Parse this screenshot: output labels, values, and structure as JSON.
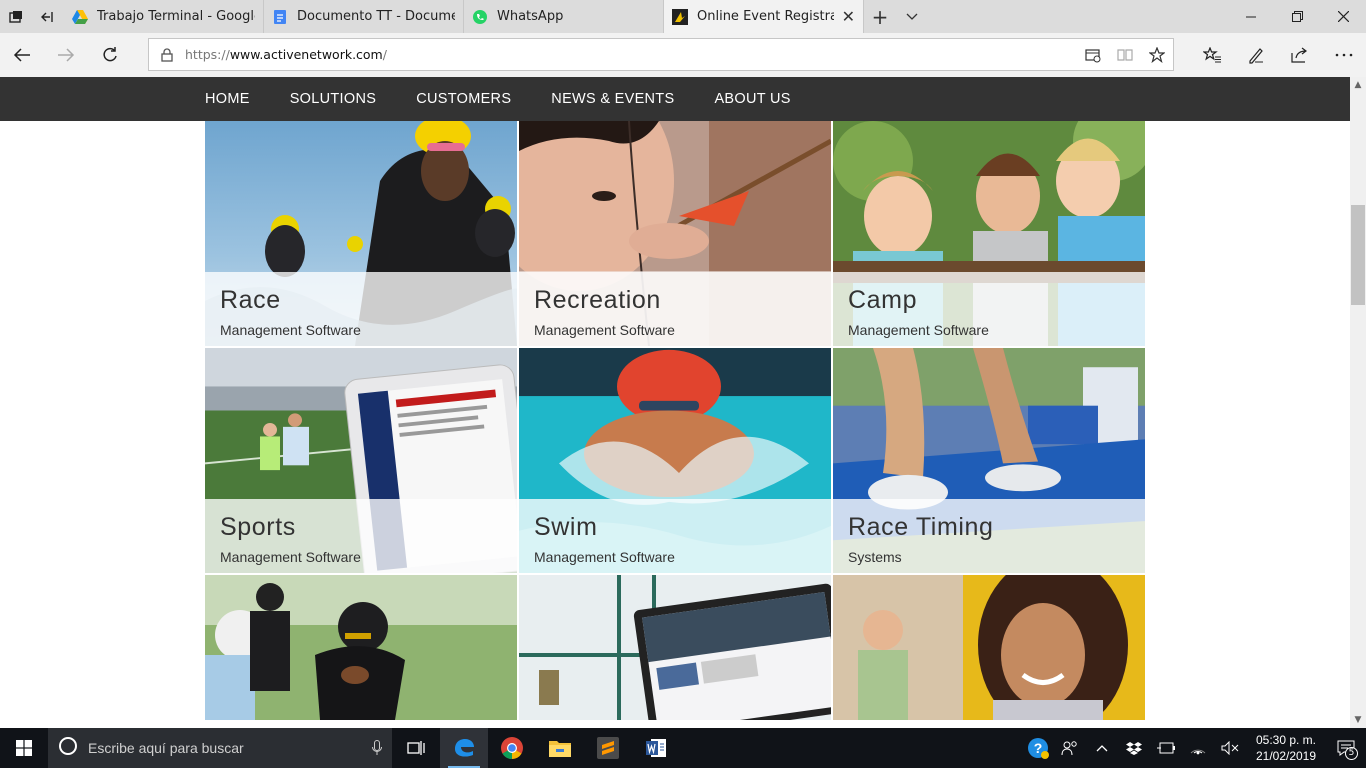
{
  "browser": {
    "tabs": [
      {
        "title": "Trabajo Terminal - Google D",
        "favicon": "google-drive-icon",
        "active": false
      },
      {
        "title": "Documento TT - Document",
        "favicon": "google-docs-icon",
        "active": false
      },
      {
        "title": "WhatsApp",
        "favicon": "whatsapp-icon",
        "active": false
      },
      {
        "title": "Online Event Registratic",
        "favicon": "active-network-icon",
        "active": true
      }
    ],
    "url_prefix": "https://",
    "url_host": "www.activenetwork.com",
    "url_path": "/"
  },
  "site": {
    "nav": [
      "HOME",
      "SOLUTIONS",
      "CUSTOMERS",
      "NEWS & EVENTS",
      "ABOUT US"
    ],
    "tiles": [
      {
        "name": "Race",
        "sub": "Management Software",
        "scene": "triathlon-swimmers"
      },
      {
        "name": "Recreation",
        "sub": "Management Software",
        "scene": "archery-girl"
      },
      {
        "name": "Camp",
        "sub": "Management Software",
        "scene": "camp-kids"
      },
      {
        "name": "Sports",
        "sub": "Management Software",
        "scene": "soccer-tablet"
      },
      {
        "name": "Swim",
        "sub": "Management Software",
        "scene": "swimmer"
      },
      {
        "name": "Race Timing",
        "sub": "Systems",
        "scene": "runners-feet"
      },
      {
        "name": "",
        "sub": "",
        "scene": "football-players"
      },
      {
        "name": "",
        "sub": "",
        "scene": "laptop-ropes-course"
      },
      {
        "name": "",
        "sub": "",
        "scene": "school-bus-girl"
      }
    ]
  },
  "taskbar": {
    "search_placeholder": "Escribe aquí para buscar",
    "time": "05:30 p. m.",
    "date": "21/02/2019",
    "notifications": "5"
  },
  "colors": {
    "site_nav_bg": "#333333",
    "taskbar_bg": "#101318",
    "edge_blue": "#0078d7"
  }
}
